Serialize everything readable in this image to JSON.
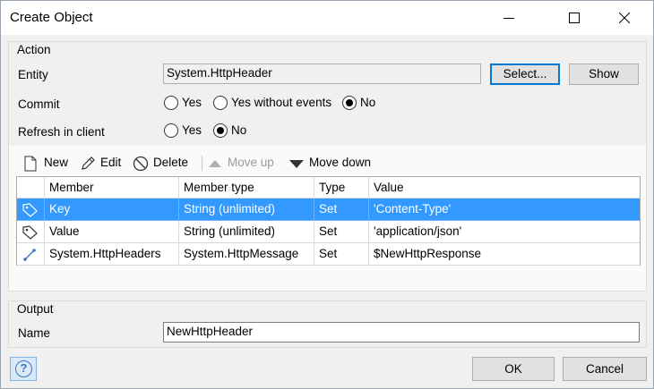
{
  "window": {
    "title": "Create Object"
  },
  "action": {
    "group_title": "Action",
    "entity": {
      "label": "Entity",
      "value": "System.HttpHeader",
      "select_label": "Select...",
      "show_label": "Show"
    },
    "commit": {
      "label": "Commit",
      "options": [
        "Yes",
        "Yes without events",
        "No"
      ],
      "selected": "No"
    },
    "refresh": {
      "label": "Refresh in client",
      "options": [
        "Yes",
        "No"
      ],
      "selected": "No"
    }
  },
  "toolbar": {
    "new": "New",
    "edit": "Edit",
    "delete": "Delete",
    "move_up": "Move up",
    "move_down": "Move down"
  },
  "table": {
    "columns": [
      "Member",
      "Member type",
      "Type",
      "Value"
    ],
    "rows": [
      {
        "icon": "tag-icon",
        "member": "Key",
        "member_type": "String (unlimited)",
        "type": "Set",
        "value": "'Content-Type'",
        "selected": true
      },
      {
        "icon": "tag-icon",
        "member": "Value",
        "member_type": "String (unlimited)",
        "type": "Set",
        "value": "'application/json'",
        "selected": false
      },
      {
        "icon": "association-icon",
        "member": "System.HttpHeaders",
        "member_type": "System.HttpMessage",
        "type": "Set",
        "value": "$NewHttpResponse",
        "selected": false
      }
    ]
  },
  "output": {
    "group_title": "Output",
    "name_label": "Name",
    "name_value": "NewHttpHeader"
  },
  "footer": {
    "ok": "OK",
    "cancel": "Cancel"
  },
  "colors": {
    "selection": "#3399ff",
    "default_button_border": "#0078d7"
  }
}
